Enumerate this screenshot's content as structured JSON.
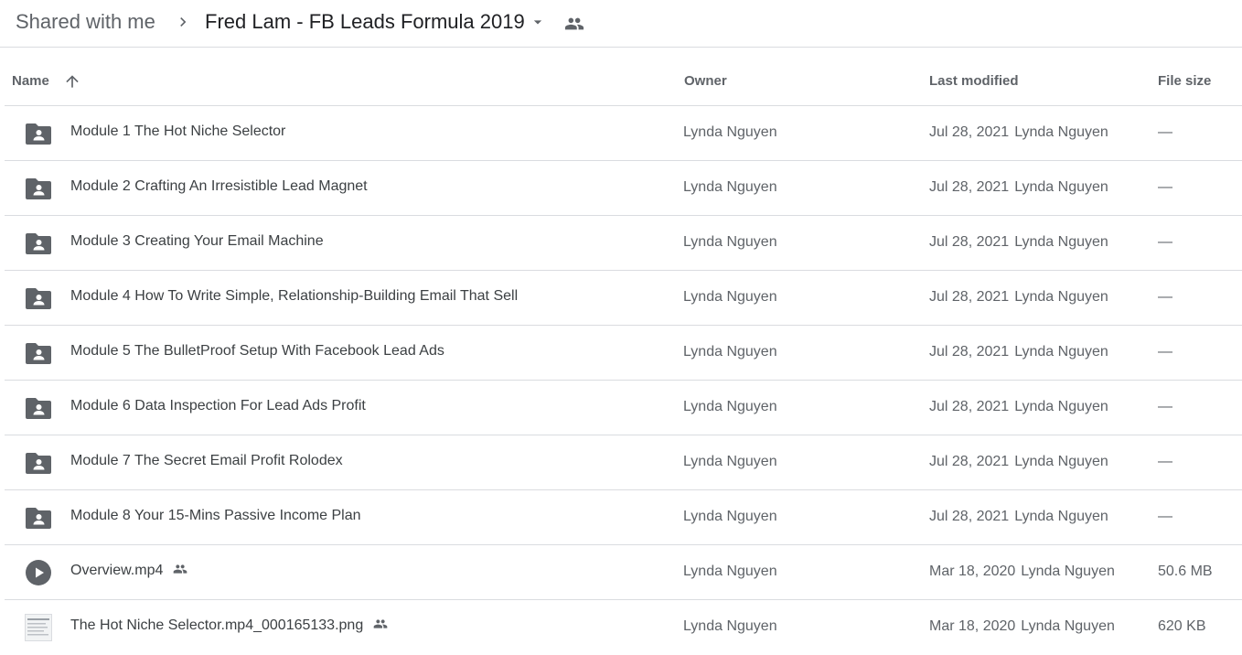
{
  "breadcrumb": {
    "root": "Shared with me",
    "current": "Fred Lam - FB Leads Formula 2019"
  },
  "columns": {
    "name": "Name",
    "owner": "Owner",
    "last_modified": "Last modified",
    "file_size": "File size"
  },
  "files": [
    {
      "name": "Module 1 The Hot Niche Selector",
      "type": "folder",
      "owner": "Lynda Nguyen",
      "date": "Jul 28, 2021",
      "modified_by": "Lynda Nguyen",
      "size": "—"
    },
    {
      "name": "Module 2 Crafting An Irresistible Lead Magnet",
      "type": "folder",
      "owner": "Lynda Nguyen",
      "date": "Jul 28, 2021",
      "modified_by": "Lynda Nguyen",
      "size": "—"
    },
    {
      "name": "Module 3 Creating Your Email Machine",
      "type": "folder",
      "owner": "Lynda Nguyen",
      "date": "Jul 28, 2021",
      "modified_by": "Lynda Nguyen",
      "size": "—"
    },
    {
      "name": "Module 4 How To Write Simple, Relationship-Building Email That Sell",
      "type": "folder",
      "owner": "Lynda Nguyen",
      "date": "Jul 28, 2021",
      "modified_by": "Lynda Nguyen",
      "size": "—"
    },
    {
      "name": "Module 5 The BulletProof Setup With Facebook Lead Ads",
      "type": "folder",
      "owner": "Lynda Nguyen",
      "date": "Jul 28, 2021",
      "modified_by": "Lynda Nguyen",
      "size": "—"
    },
    {
      "name": "Module 6 Data Inspection For Lead Ads Profit",
      "type": "folder",
      "owner": "Lynda Nguyen",
      "date": "Jul 28, 2021",
      "modified_by": "Lynda Nguyen",
      "size": "—"
    },
    {
      "name": "Module 7 The Secret Email Profit Rolodex",
      "type": "folder",
      "owner": "Lynda Nguyen",
      "date": "Jul 28, 2021",
      "modified_by": "Lynda Nguyen",
      "size": "—"
    },
    {
      "name": "Module 8 Your 15-Mins Passive Income Plan",
      "type": "folder",
      "owner": "Lynda Nguyen",
      "date": "Jul 28, 2021",
      "modified_by": "Lynda Nguyen",
      "size": "—"
    },
    {
      "name": "Overview.mp4",
      "type": "video",
      "shared": true,
      "owner": "Lynda Nguyen",
      "date": "Mar 18, 2020",
      "modified_by": "Lynda Nguyen",
      "size": "50.6 MB"
    },
    {
      "name": "The Hot Niche Selector.mp4_000165133.png",
      "type": "image",
      "shared": true,
      "owner": "Lynda Nguyen",
      "date": "Mar 18, 2020",
      "modified_by": "Lynda Nguyen",
      "size": "620 KB"
    }
  ],
  "icons": {
    "breadcrumb_separator": "chevron-right-icon",
    "folder_menu": "caret-down-icon",
    "shared": "people-icon",
    "sort": "arrow-up-icon",
    "folder": "shared-folder-icon",
    "video": "play-icon",
    "image": "image-thumbnail-icon"
  },
  "colors": {
    "text_primary": "#202124",
    "text_secondary": "#5f6368",
    "icon": "#5f6368",
    "divider": "#dadce0"
  }
}
